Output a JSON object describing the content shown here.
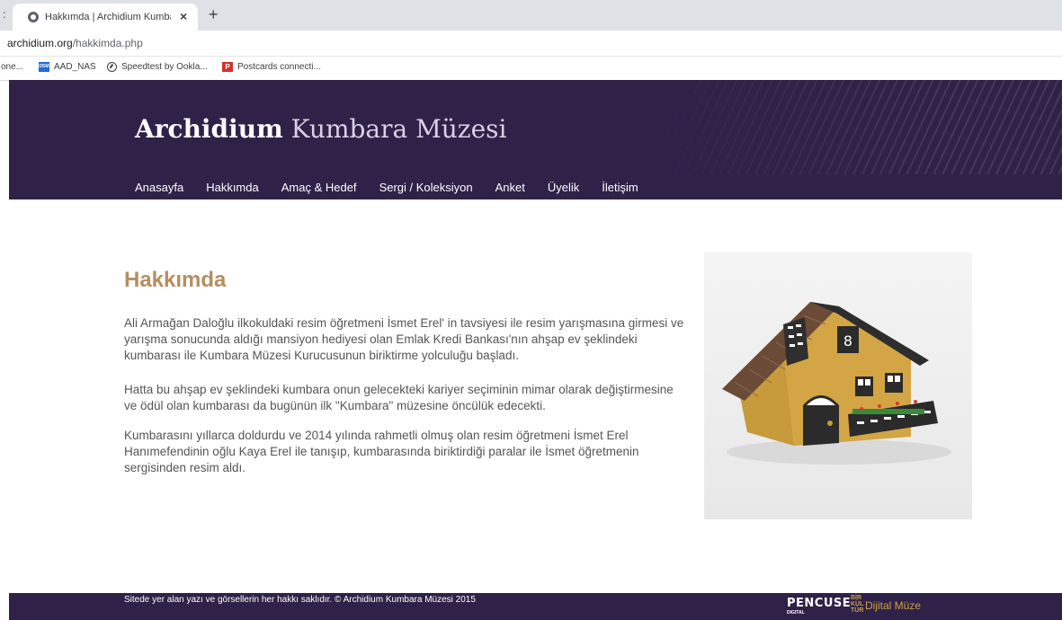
{
  "browser": {
    "left_menu_glyph": ":",
    "tab_title": "Hakkımda | Archidium Kumbara M",
    "tab_close": "×",
    "new_tab": "+",
    "url_domain": "archidium.org",
    "url_path": "/hakkimda.php",
    "bookmarks": [
      {
        "label": "one...",
        "icon": "none"
      },
      {
        "label": "AAD_NAS",
        "icon": "dsm-icon",
        "icon_text": "DSM"
      },
      {
        "label": "Speedtest by Ookla...",
        "icon": "speedtest-icon"
      },
      {
        "label": "Postcards connecti...",
        "icon": "postcards-icon",
        "icon_text": "P"
      }
    ]
  },
  "site": {
    "title_bold": "Archidium",
    "title_light": "Kumbara Müzesi",
    "nav": [
      "Anasayfa",
      "Hakkımda",
      "Amaç & Hedef",
      "Sergi / Koleksiyon",
      "Anket",
      "Üyelik",
      "İletişim"
    ],
    "colors": {
      "header_bg": "#2f2148",
      "heading": "#b68e5e",
      "footer_accent": "#c9a14a"
    }
  },
  "main": {
    "heading": "Hakkımda",
    "paragraphs": [
      "Ali Armağan Daloğlu ilkokuldaki resim öğretmeni İsmet Erel' in tavsiyesi ile resim yarışmasına girmesi ve yarışma sonucunda aldığı mansiyon hediyesi olan Emlak Kredi Bankası'nın ahşap ev şeklindeki kumbarası ile Kumbara Müzesi Kurucusunun biriktirme yolculuğu başladı.",
      "Hatta bu ahşap ev şeklindeki kumbara onun gelecekteki kariyer seçiminin mimar olarak değiştirmesine ve ödül olan kumbarası da bugünün ilk \"Kumbara\" müzesine öncülük edecekti.",
      "Kumbarasını yıllarca doldurdu ve 2014 yılında rahmetli olmuş olan resim öğretmeni İsmet Erel Hanımefendinin oğlu Kaya Erel ile tanışıp, kumbarasında biriktirdiği paralar ile İsmet öğretmenin sergisinden resim aldı."
    ]
  },
  "footer": {
    "copyright": "Sitede yer alan yazı ve görsellerin her hakkı saklıdır. © Archidium Kumbara Müzesi 2015",
    "pencuse": "PENCUSE",
    "pencuse_sub": "DIGITAL",
    "birkultur_lines": [
      "BİR",
      "KÜL",
      "TÜR"
    ],
    "dijital": "Dijital Müze"
  }
}
